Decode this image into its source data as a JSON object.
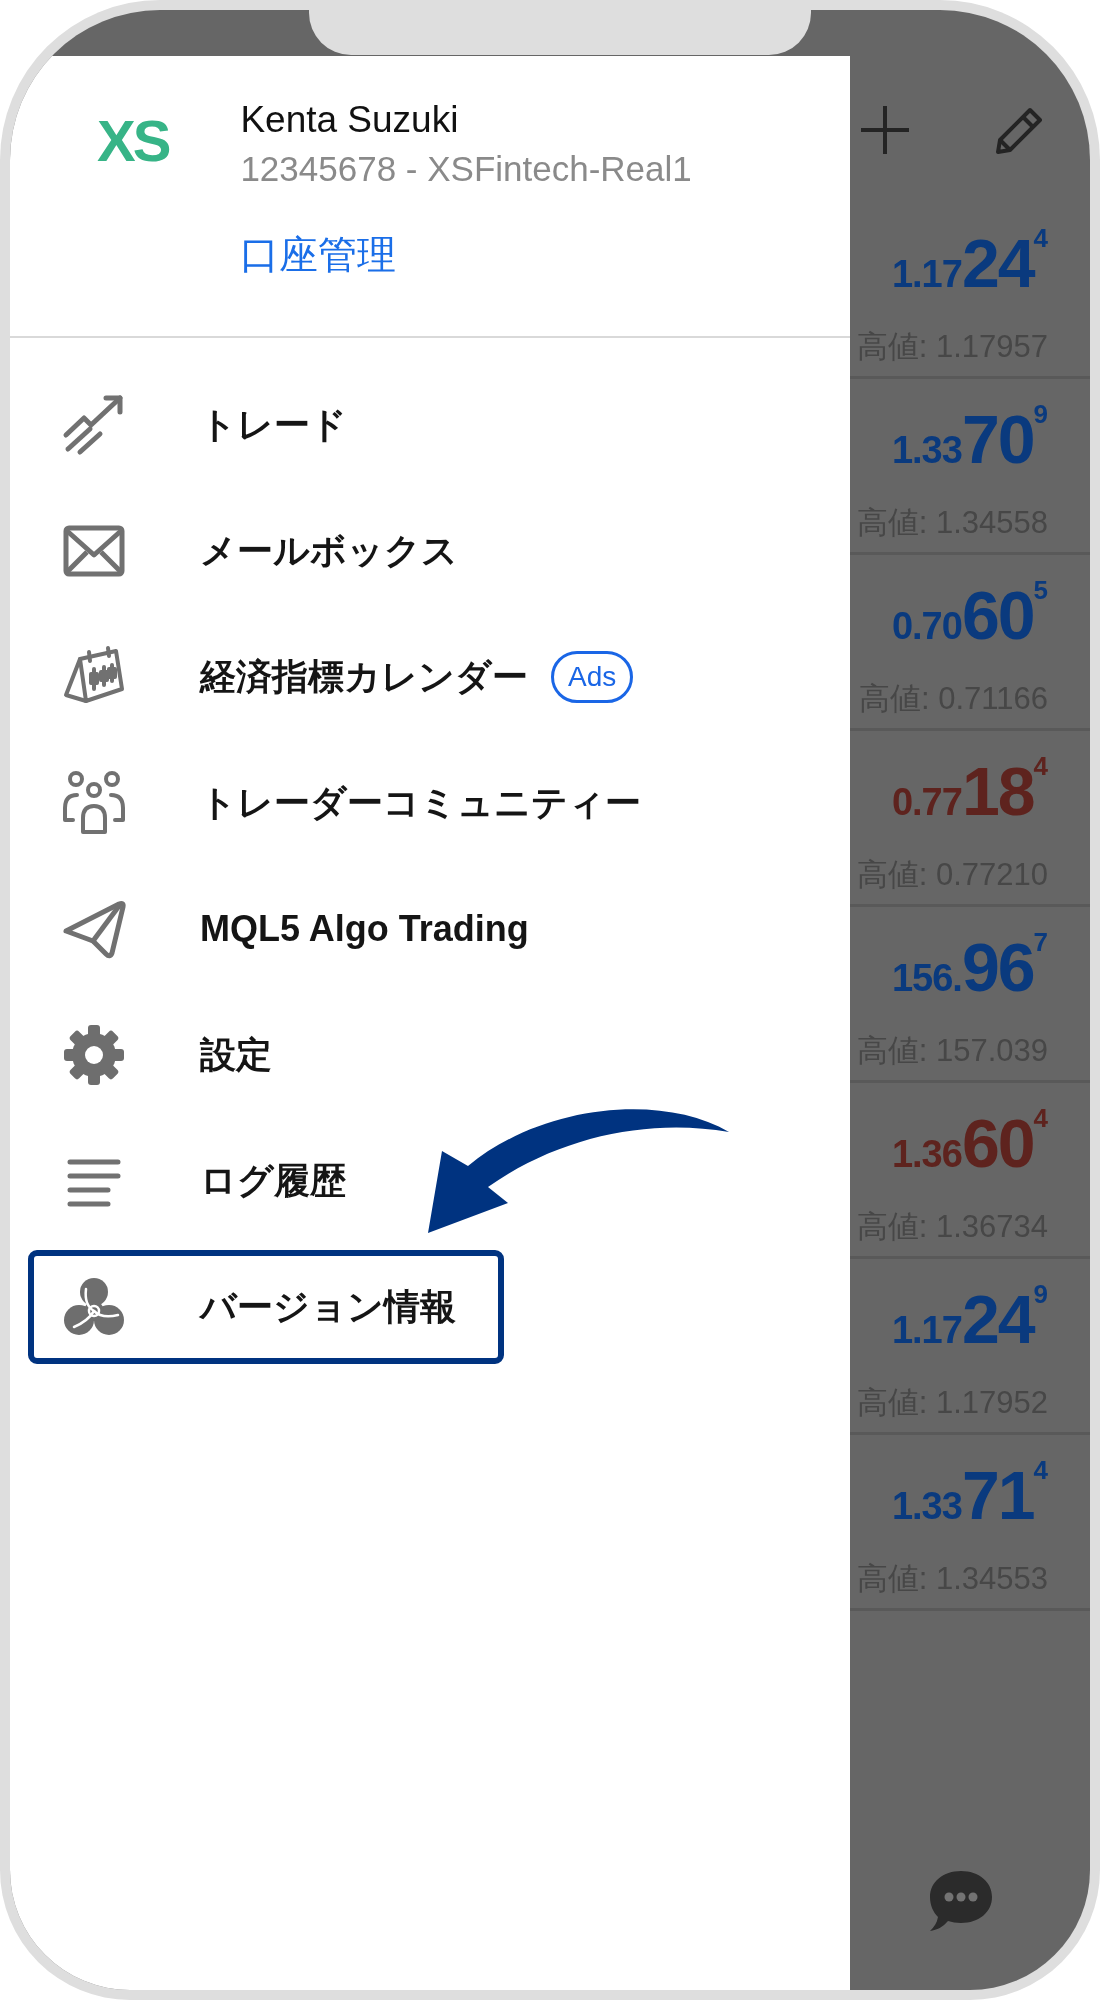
{
  "account": {
    "logo": "XS",
    "name": "Kenta Suzuki",
    "number": "12345678 - XSFintech-Real1",
    "manage_link": "口座管理"
  },
  "menu": {
    "items": [
      {
        "label": "トレード",
        "highlighted": false
      },
      {
        "label": "メールボックス",
        "highlighted": false
      },
      {
        "label": "経済指標カレンダー",
        "badge": "Ads",
        "highlighted": false
      },
      {
        "label": "トレーダーコミュニティー",
        "highlighted": false
      },
      {
        "label": "MQL5 Algo Trading",
        "highlighted": false
      },
      {
        "label": "設定",
        "highlighted": false
      },
      {
        "label": "ログ履歴",
        "highlighted": false
      },
      {
        "label": "バージョン情報",
        "highlighted": true
      }
    ]
  },
  "quotes": [
    {
      "price_head": "1.17",
      "price_pips": "24",
      "price_point": "4",
      "high": "高値: 1.17957",
      "color": "#0a3a7e"
    },
    {
      "price_head": "1.33",
      "price_pips": "70",
      "price_point": "9",
      "high": "高値: 1.34558",
      "color": "#0a3a7e"
    },
    {
      "price_head": "0.70",
      "price_pips": "60",
      "price_point": "5",
      "high": "高値: 0.71166",
      "color": "#0a3a7e"
    },
    {
      "price_head": "0.77",
      "price_pips": "18",
      "price_point": "4",
      "high": "高値: 0.77210",
      "color": "#5e231e"
    },
    {
      "price_head": "156.",
      "price_pips": "96",
      "price_point": "7",
      "high": "高値: 157.039",
      "color": "#0a3a7e"
    },
    {
      "price_head": "1.36",
      "price_pips": "60",
      "price_point": "4",
      "high": "高値: 1.36734",
      "color": "#5e231e"
    },
    {
      "price_head": "1.17",
      "price_pips": "24",
      "price_point": "9",
      "high": "高値: 1.17952",
      "color": "#0a3a7e"
    },
    {
      "price_head": "1.33",
      "price_pips": "71",
      "price_point": "4",
      "high": "高値: 1.34553",
      "color": "#0a3a7e"
    }
  ]
}
